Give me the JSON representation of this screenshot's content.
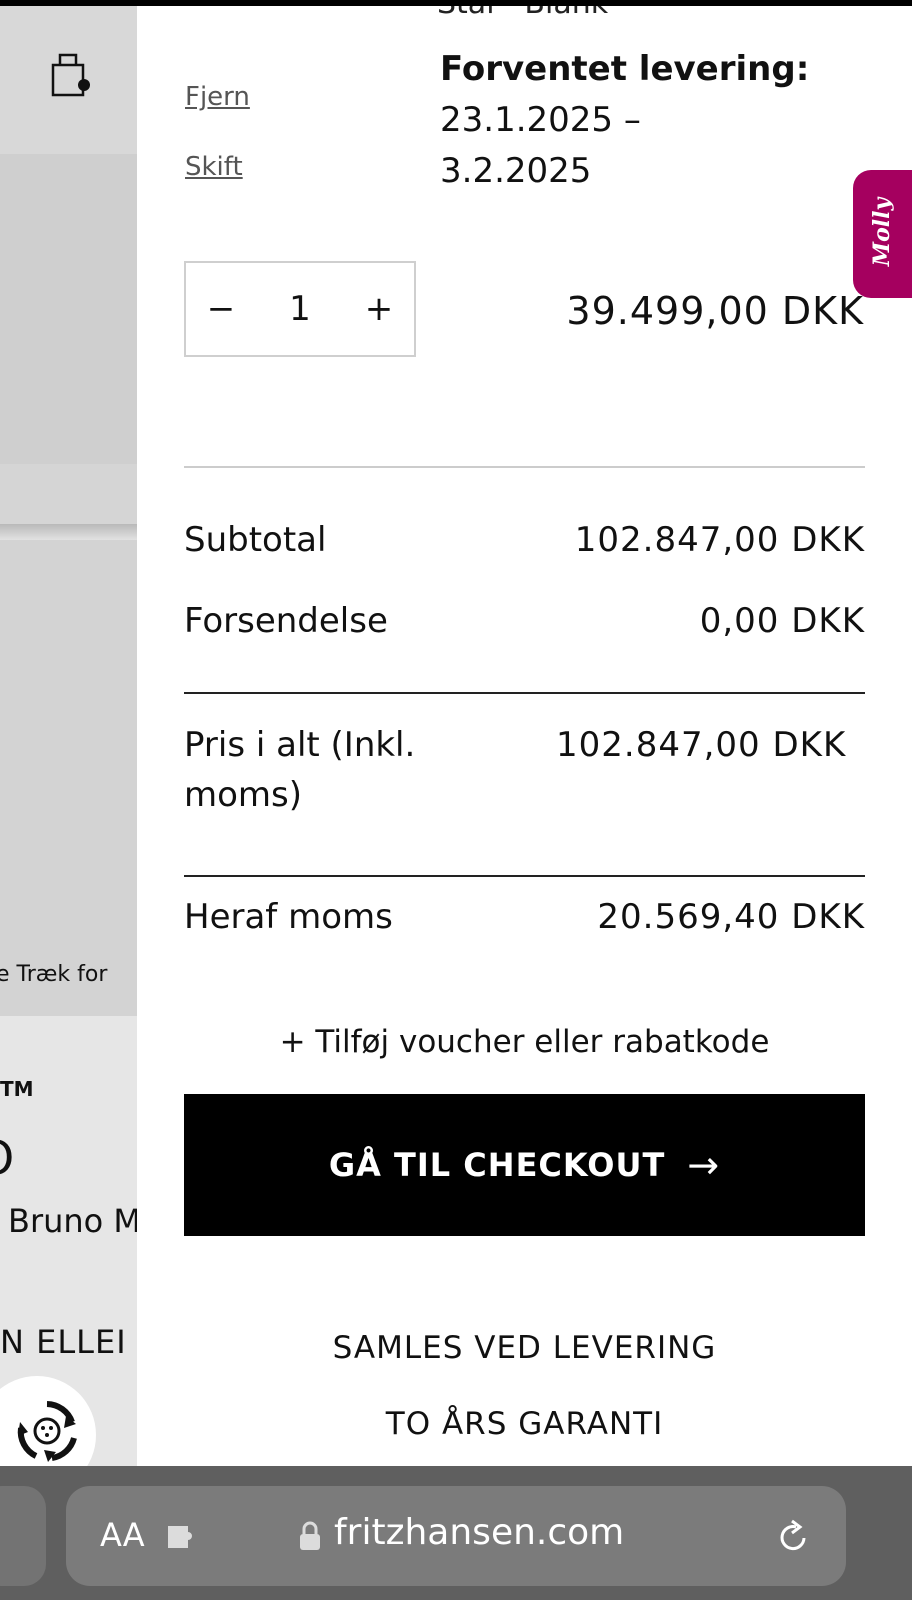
{
  "background_page": {
    "drag_hint": "e   Træk for",
    "trademark": "TM",
    "product_letter": "O",
    "designer": "Bruno M",
    "option_text": "N ELLEI"
  },
  "cart": {
    "variant_partial": "Stål - Blank",
    "remove_link": "Fjern",
    "change_link": "Skift",
    "delivery_label": "Forventet levering:",
    "delivery_from": "23.1.2025 –",
    "delivery_to": "3.2.2025",
    "quantity": "1",
    "minus": "−",
    "plus": "+",
    "item_price": "39.499,00 DKK"
  },
  "summary": {
    "subtotal_label": "Subtotal",
    "subtotal_value": "102.847,00 DKK",
    "shipping_label": "Forsendelse",
    "shipping_value": "0,00 DKK",
    "total_label": "Pris i alt (Inkl. moms)",
    "total_value": "102.847,00 DKK",
    "vat_label": "Heraf moms",
    "vat_value": "20.569,40 DKK"
  },
  "voucher_label": "+ Tilføj voucher eller rabatkode",
  "checkout": {
    "label": "GÅ TIL CHECKOUT",
    "arrow": "→"
  },
  "usps": [
    "SAMLES VED LEVERING",
    "TO ÅRS GARANTI"
  ],
  "molly_label": "Molly",
  "browser": {
    "text_size_button": "AA",
    "url_host": "fritzhansen.com"
  },
  "colors": {
    "molly_brand": "#a5005f",
    "checkout_bg": "#000000"
  }
}
